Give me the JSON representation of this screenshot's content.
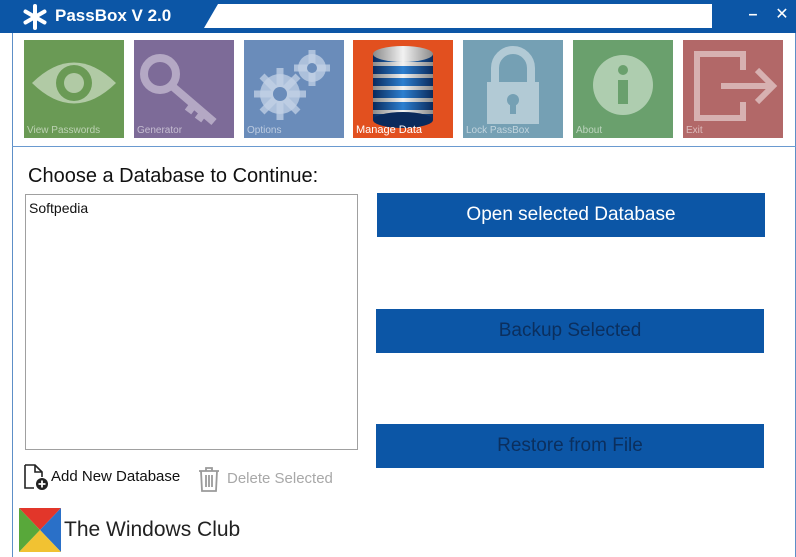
{
  "window": {
    "title": "PassBox V 2.0",
    "minimize_glyph": "–",
    "close_glyph": "✕"
  },
  "tiles": [
    {
      "label": "View Passwords",
      "icon": "eye-icon",
      "color": "#6a9a55"
    },
    {
      "label": "Generator",
      "icon": "key-icon",
      "color": "#7d6b98"
    },
    {
      "label": "Options",
      "icon": "gears-icon",
      "color": "#6a8cba"
    },
    {
      "label": "Manage Data",
      "icon": "database-icon",
      "color": "#e2501f"
    },
    {
      "label": "Lock PassBox",
      "icon": "lock-icon",
      "color": "#75a0b4"
    },
    {
      "label": "About",
      "icon": "info-icon",
      "color": "#6aa06d"
    },
    {
      "label": "Exit",
      "icon": "exit-icon",
      "color": "#b26868"
    }
  ],
  "main": {
    "choose_label": "Choose a Database to Continue:",
    "databases": [
      "Softpedia"
    ],
    "open_button": "Open selected Database",
    "backup_button": "Backup Selected",
    "restore_button": "Restore from File",
    "add_label": "Add New Database",
    "delete_label": "Delete Selected"
  },
  "branding": {
    "name": "The Windows Club"
  },
  "colors": {
    "titlebar": "#0c56a6",
    "button": "#0c56a6"
  }
}
